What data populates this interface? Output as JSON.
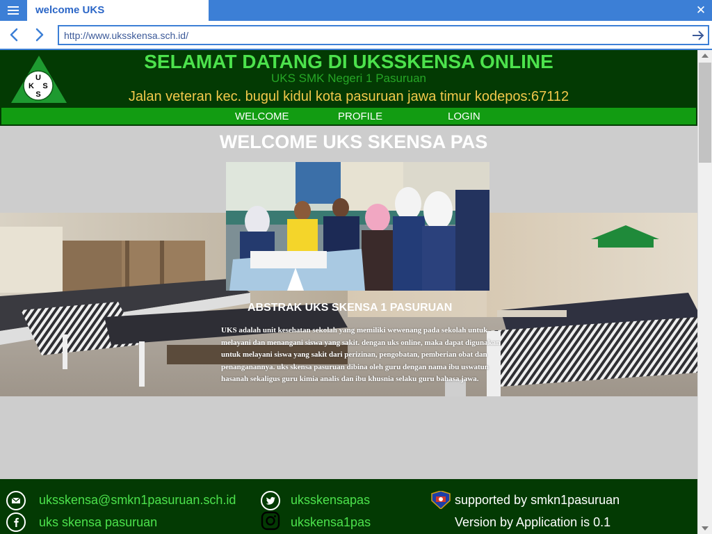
{
  "browser": {
    "tab_title": "welcome UKS",
    "close_glyph": "✕",
    "url": "http://www.uksskensa.sch.id/"
  },
  "header": {
    "title": "SELAMAT DATANG DI UKSSKENSA ONLINE",
    "subtitle": "UKS SMK Negeri 1 Pasuruan",
    "address": "Jalan veteran kec. bugul kidul kota pasuruan jawa timur kodepos:67112",
    "logo_letters": [
      "U",
      "K",
      "S",
      "S"
    ]
  },
  "nav": {
    "items": [
      {
        "label": "WELCOME"
      },
      {
        "label": "PROFILE"
      },
      {
        "label": "LOGIN"
      }
    ]
  },
  "main": {
    "heading": "WELCOME UKS SKENSA PAS",
    "abstract_title": "ABSTRAK UKS SKENSA 1 PASURUAN",
    "abstract_text": "UKS adalah unit kesehatan sekolah yang memiliki wewenang pada sekolah untuk melayani dan menangani siswa yang sakit. dengan uks online, maka dapat digunakan untuk melayani siswa yang sakit dari perizinan, pengobatan, pemberian obat dan penanganannya. uks skensa pasuruan dibina oleh guru dengan nama ibu uswatun hasanah sekaligus guru kimia analis dan ibu khusnia selaku guru bahasa jawa."
  },
  "footer": {
    "email": "uksskensa@smkn1pasuruan.sch.id",
    "facebook": "uks skensa pasuruan",
    "twitter": "uksskensapas",
    "instagram": "ukskensa1pas",
    "supported": "supported by smkn1pasuruan",
    "version": "Version by Application is 0.1"
  },
  "colors": {
    "browser_blue": "#3c7fd6",
    "header_bg": "#033a03",
    "title_green": "#4ce24c",
    "address_yellow": "#f2c84b",
    "nav_green": "#129c12",
    "page_grey": "#cdcdcd"
  },
  "icons": [
    "menu-icon",
    "back-arrow-icon",
    "forward-arrow-icon",
    "go-arrow-icon",
    "close-icon",
    "email-icon",
    "facebook-icon",
    "twitter-icon",
    "instagram-icon",
    "school-emblem-icon",
    "uks-logo"
  ]
}
